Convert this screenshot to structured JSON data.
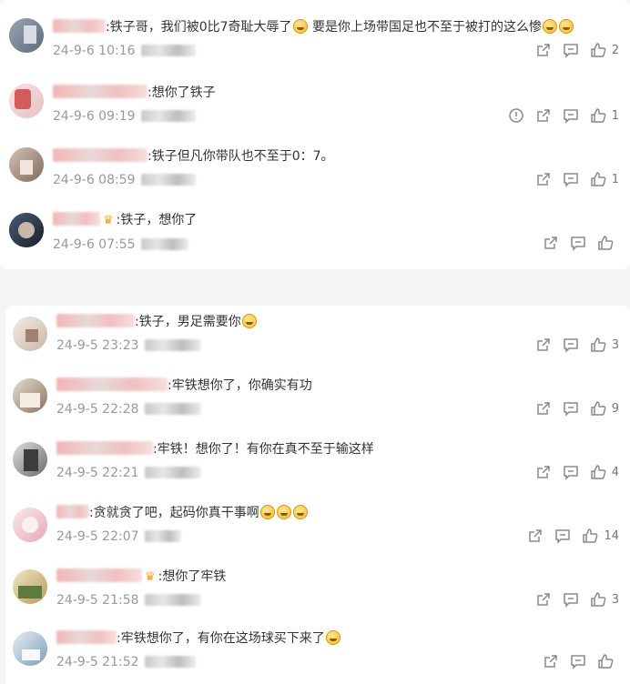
{
  "card1": {
    "comments": [
      {
        "text": ":铁子哥，我们被0比7奇耻大辱了",
        "tail": " 要是你上场带国足也不至于被打的这么惨",
        "time": "24-9-6 10:16",
        "likes": "2"
      },
      {
        "text": ":想你了铁子",
        "time": "24-9-6 09:19",
        "likes": "1"
      },
      {
        "text": ":铁子但凡你带队也不至于0：7。",
        "time": "24-9-6 08:59",
        "likes": "1"
      },
      {
        "text": ":铁子，想你了",
        "time": "24-9-6 07:55",
        "likes": ""
      }
    ]
  },
  "card2": {
    "comments": [
      {
        "text": ":铁子，男足需要你",
        "time": "24-9-5 23:23",
        "likes": "3"
      },
      {
        "text": ":牢铁想你了，你确实有功",
        "time": "24-9-5 22:28",
        "likes": "9"
      },
      {
        "text": ":牢铁！想你了！有你在真不至于输这样",
        "time": "24-9-5 22:21",
        "likes": "4"
      },
      {
        "text": ":贪就贪了吧，起码你真干事啊",
        "time": "24-9-5 22:07",
        "likes": "14"
      },
      {
        "text": ":想你了牢铁",
        "time": "24-9-5 21:58",
        "likes": "3"
      },
      {
        "text": ":牢铁想你了，有你在这场球买下来了",
        "time": "24-9-5 21:52",
        "likes": ""
      }
    ]
  },
  "icons": {
    "share": "share-icon",
    "comment": "comment-icon",
    "like": "like-icon",
    "report": "report-icon"
  }
}
